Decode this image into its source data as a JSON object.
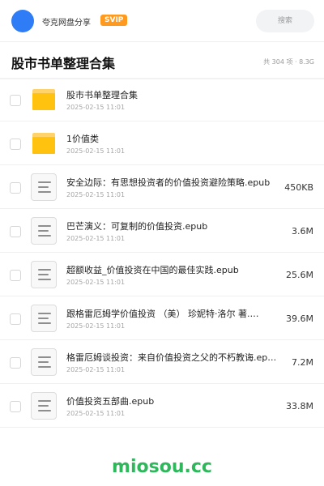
{
  "header": {
    "brand": "夸克网盘分享",
    "badge": "SVIP",
    "search_placeholder": "搜索"
  },
  "folder": {
    "title": "股市书单整理合集",
    "count": "共 304 项 · 8.3G"
  },
  "files": [
    {
      "type": "folder",
      "name": "股市书单整理合集",
      "date": "2025-02-15 11:01",
      "size": ""
    },
    {
      "type": "folder",
      "name": "1价值类",
      "date": "2025-02-15 11:01",
      "size": ""
    },
    {
      "type": "file",
      "name": "安全边际：有思想投资者的价值投资避险策略.epub",
      "date": "2025-02-15 11:01",
      "size": "450KB"
    },
    {
      "type": "file",
      "name": "巴芒演义：可复制的价值投资.epub",
      "date": "2025-02-15 11:01",
      "size": "3.6M"
    },
    {
      "type": "file",
      "name": "超额收益_价值投资在中国的最佳实践.epub",
      "date": "2025-02-15 11:01",
      "size": "25.6M"
    },
    {
      "type": "file",
      "name": "跟格雷厄姆学价值投资 （美） 珍妮特·洛尔 著.…",
      "date": "2025-02-15 11:01",
      "size": "39.6M"
    },
    {
      "type": "file",
      "name": "格雷厄姆谈投资：来自价值投资之父的不朽教诲.epub",
      "date": "2025-02-15 11:01",
      "size": "7.2M"
    },
    {
      "type": "file",
      "name": "价值投资五部曲.epub",
      "date": "2025-02-15 11:01",
      "size": "33.8M"
    }
  ],
  "watermark": "miosou.cc",
  "colors": {
    "accent": "#2f7df6",
    "badge": "#ff9a1f",
    "folder": "#ffc20e",
    "watermark": "#2fb75b"
  }
}
